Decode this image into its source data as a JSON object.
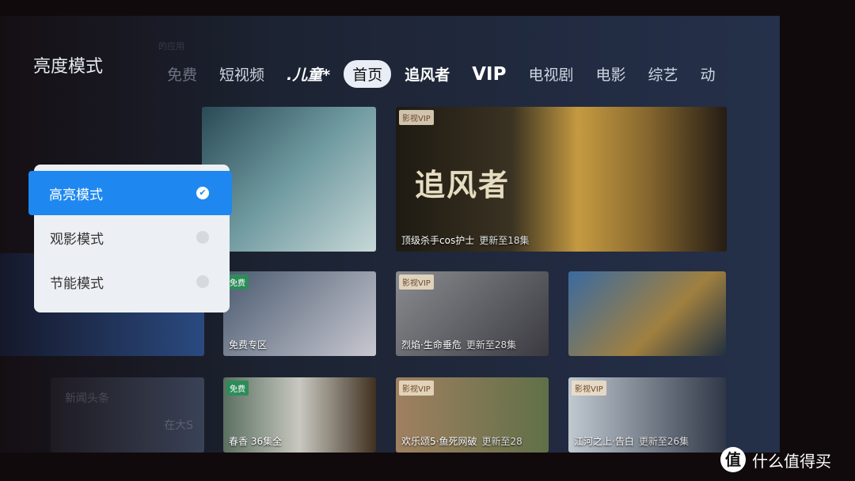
{
  "header": {
    "title": "亮度模式",
    "hint": "的应用"
  },
  "tabs": [
    {
      "label": "免费",
      "style": "dim"
    },
    {
      "label": "短视频",
      "style": ""
    },
    {
      "label": ".儿童*",
      "style": "logo"
    },
    {
      "label": "首页",
      "style": "active"
    },
    {
      "label": "追风者",
      "style": "bold"
    },
    {
      "label": "VIP",
      "style": "vip"
    },
    {
      "label": "电视剧",
      "style": ""
    },
    {
      "label": "电影",
      "style": ""
    },
    {
      "label": "综艺",
      "style": ""
    },
    {
      "label": "动",
      "style": ""
    }
  ],
  "hero": {
    "badge": "影视VIP",
    "logo_text": "追风者",
    "caption": "顶级杀手cos护士",
    "update": "更新至18集"
  },
  "row2": [
    {
      "badge": "免费",
      "caption": "免费专区",
      "update": ""
    },
    {
      "badge": "影视VIP",
      "caption": "烈焰·生命垂危",
      "update": "更新至28集"
    },
    {
      "badge": "",
      "caption": "",
      "update": ""
    }
  ],
  "row3": [
    {
      "badge": "免费",
      "caption": "春香 36集全",
      "update": ""
    },
    {
      "badge": "影视VIP",
      "caption": "欢乐颂5·鱼死网破",
      "update": "更新至28"
    },
    {
      "badge": "影视VIP",
      "caption": "江河之上·告白",
      "update": "更新至26集"
    }
  ],
  "news": {
    "title": "新闻头条",
    "text": "在大S"
  },
  "brightness_menu": {
    "items": [
      {
        "label": "高亮模式",
        "selected": true
      },
      {
        "label": "观影模式",
        "selected": false
      },
      {
        "label": "节能模式",
        "selected": false
      }
    ],
    "accent": "#1e88f0"
  },
  "watermark": {
    "icon": "值",
    "text": "什么值得买"
  }
}
